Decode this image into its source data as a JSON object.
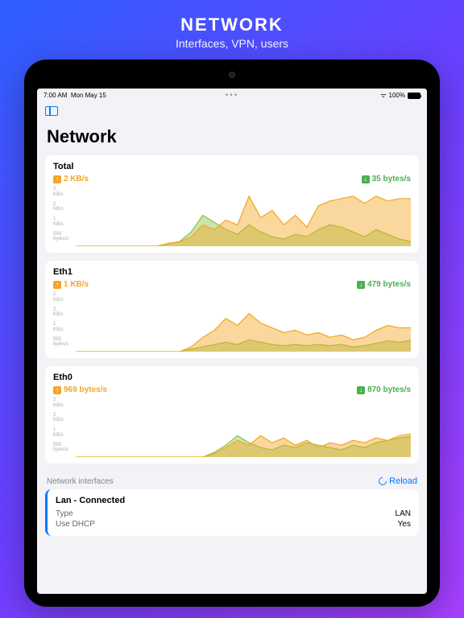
{
  "hero": {
    "title": "NETWORK",
    "subtitle": "Interfaces, VPN, users"
  },
  "status": {
    "time": "7:00 AM",
    "date": "Mon May 15",
    "battery": "100%"
  },
  "page_title": "Network",
  "y_ticks": [
    "2\nKB/s",
    "2\nKB/s",
    "1\nKB/s",
    "593\nbytes/s",
    ""
  ],
  "charts": [
    {
      "name": "Total",
      "up": "2 KB/s",
      "down": "35 bytes/s"
    },
    {
      "name": "Eth1",
      "up": "1 KB/s",
      "down": "479 bytes/s"
    },
    {
      "name": "Eth0",
      "up": "969 bytes/s",
      "down": "870 bytes/s"
    }
  ],
  "interfaces_section": {
    "label": "Network interfaces",
    "reload": "Reload"
  },
  "interface": {
    "name": "Lan - Connected",
    "rows": [
      {
        "k": "Type",
        "v": "LAN"
      },
      {
        "k": "Use DHCP",
        "v": "Yes"
      }
    ]
  },
  "chart_data": [
    {
      "type": "area",
      "title": "Total",
      "ylabel": "bytes/s → KB/s",
      "ylim": [
        0,
        2500
      ],
      "x": [
        0,
        1,
        2,
        3,
        4,
        5,
        6,
        7,
        8,
        9,
        10,
        11,
        12,
        13,
        14,
        15,
        16,
        17,
        18,
        19,
        20,
        21,
        22,
        23,
        24,
        25,
        26,
        27,
        28,
        29
      ],
      "series": [
        {
          "name": "up",
          "color": "#f5a623",
          "values": [
            0,
            0,
            0,
            0,
            0,
            0,
            0,
            0,
            120,
            180,
            400,
            900,
            700,
            1100,
            900,
            2100,
            1200,
            1500,
            900,
            1300,
            800,
            1700,
            1900,
            2000,
            2100,
            1800,
            2100,
            1900,
            2000,
            2000
          ]
        },
        {
          "name": "down",
          "color": "#8bc34a",
          "values": [
            0,
            0,
            0,
            0,
            0,
            0,
            0,
            0,
            100,
            200,
            600,
            1300,
            1000,
            700,
            500,
            900,
            600,
            400,
            300,
            500,
            400,
            700,
            900,
            800,
            600,
            400,
            700,
            500,
            300,
            200
          ]
        }
      ]
    },
    {
      "type": "area",
      "title": "Eth1",
      "ylabel": "bytes/s → KB/s",
      "ylim": [
        0,
        2500
      ],
      "x": [
        0,
        1,
        2,
        3,
        4,
        5,
        6,
        7,
        8,
        9,
        10,
        11,
        12,
        13,
        14,
        15,
        16,
        17,
        18,
        19,
        20,
        21,
        22,
        23,
        24,
        25,
        26,
        27,
        28,
        29
      ],
      "series": [
        {
          "name": "up",
          "color": "#f5a623",
          "values": [
            0,
            0,
            0,
            0,
            0,
            0,
            0,
            0,
            0,
            0,
            200,
            600,
            900,
            1400,
            1100,
            1600,
            1200,
            1000,
            800,
            900,
            700,
            800,
            600,
            700,
            500,
            600,
            900,
            1100,
            1000,
            1000
          ]
        },
        {
          "name": "down",
          "color": "#8bc34a",
          "values": [
            0,
            0,
            0,
            0,
            0,
            0,
            0,
            0,
            0,
            0,
            100,
            200,
            300,
            400,
            300,
            500,
            400,
            300,
            250,
            300,
            250,
            300,
            250,
            300,
            200,
            250,
            350,
            450,
            400,
            479
          ]
        }
      ]
    },
    {
      "type": "area",
      "title": "Eth0",
      "ylabel": "bytes/s → KB/s",
      "ylim": [
        0,
        2500
      ],
      "x": [
        0,
        1,
        2,
        3,
        4,
        5,
        6,
        7,
        8,
        9,
        10,
        11,
        12,
        13,
        14,
        15,
        16,
        17,
        18,
        19,
        20,
        21,
        22,
        23,
        24,
        25,
        26,
        27,
        28,
        29
      ],
      "series": [
        {
          "name": "up",
          "color": "#f5a623",
          "values": [
            0,
            0,
            0,
            0,
            0,
            0,
            0,
            0,
            0,
            0,
            0,
            0,
            150,
            400,
            700,
            500,
            900,
            600,
            800,
            500,
            700,
            400,
            600,
            500,
            700,
            600,
            800,
            700,
            900,
            969
          ]
        },
        {
          "name": "down",
          "color": "#8bc34a",
          "values": [
            0,
            0,
            0,
            0,
            0,
            0,
            0,
            0,
            0,
            0,
            0,
            0,
            200,
            500,
            900,
            600,
            400,
            300,
            500,
            400,
            600,
            500,
            400,
            300,
            500,
            400,
            600,
            700,
            800,
            870
          ]
        }
      ]
    }
  ]
}
